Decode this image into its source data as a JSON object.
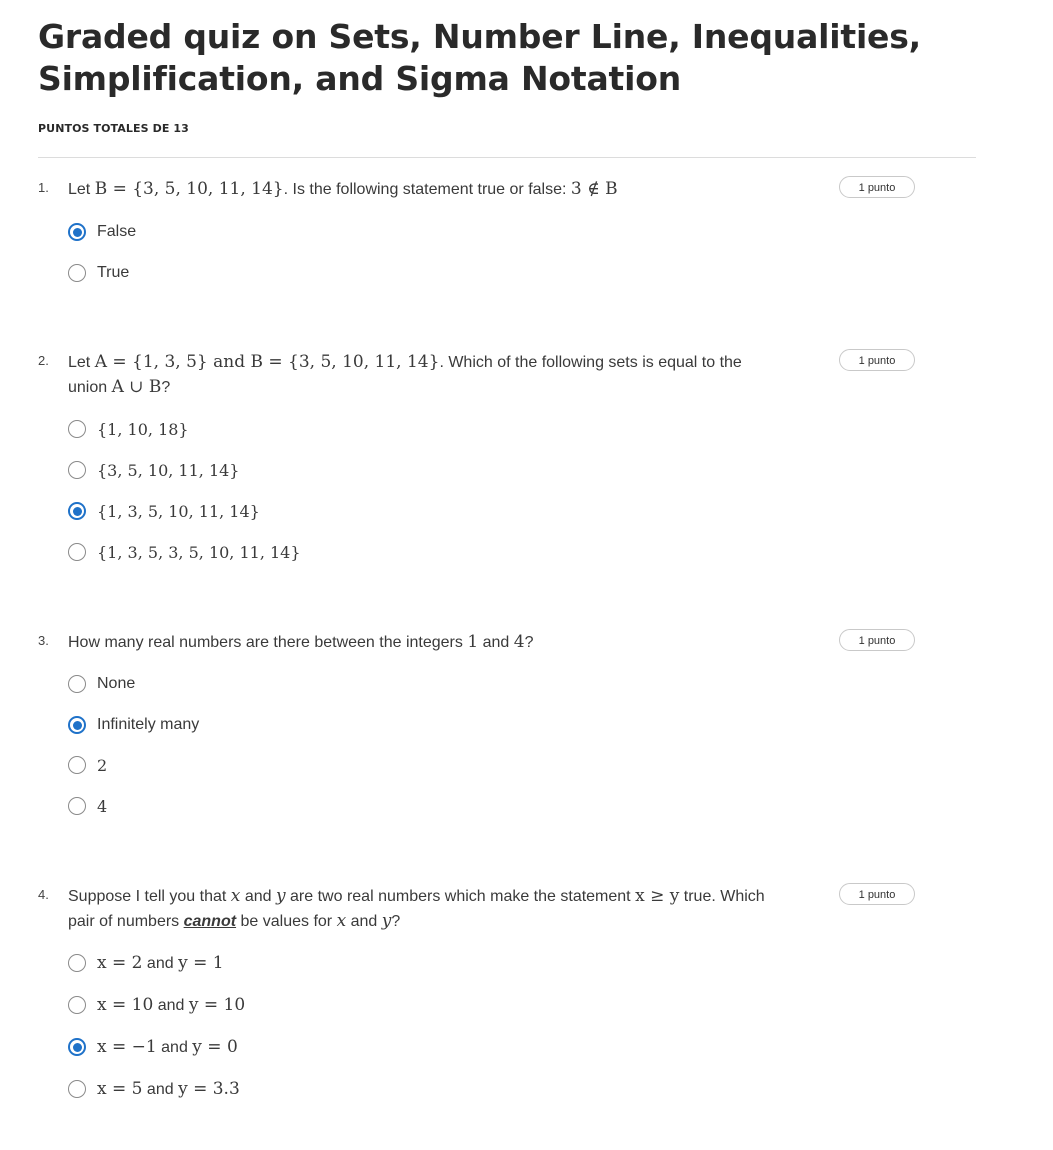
{
  "page_title": "Graded quiz on Sets, Number Line, Inequalities, Simplification, and Sigma Notation",
  "total_points": "PUNTOS TOTALES DE 13",
  "questions": [
    {
      "number": "1.",
      "points": "1 punto",
      "text_parts": [
        "Let ",
        "B = {3, 5, 10, 11, 14}",
        ". Is the following statement true or false: ",
        "3 ∉ B"
      ],
      "options": [
        {
          "label": "False",
          "selected": true
        },
        {
          "label": "True",
          "selected": false
        }
      ]
    },
    {
      "number": "2.",
      "points": "1 punto",
      "text_parts": [
        "Let ",
        "A = {1, 3, 5}",
        " and ",
        "B = {3, 5, 10, 11, 14}",
        ". Which of the following sets is equal to the union ",
        "A ∪ B",
        "?"
      ],
      "options": [
        {
          "label": "{1, 10, 18}",
          "selected": false
        },
        {
          "label": "{3, 5, 10, 11, 14}",
          "selected": false
        },
        {
          "label": "{1, 3, 5, 10, 11, 14}",
          "selected": true
        },
        {
          "label": "{1, 3, 5, 3, 5, 10, 11, 14}",
          "selected": false
        }
      ]
    },
    {
      "number": "3.",
      "points": "1 punto",
      "text_parts": [
        "How many real numbers are there between the integers ",
        "1",
        " and ",
        "4",
        "?"
      ],
      "options": [
        {
          "label": "None",
          "selected": false
        },
        {
          "label": "Infinitely many",
          "selected": true
        },
        {
          "label": "2",
          "selected": false
        },
        {
          "label": "4",
          "selected": false
        }
      ]
    },
    {
      "number": "4.",
      "points": "1 punto",
      "text_parts": [
        "Suppose I tell you that ",
        "x",
        " and ",
        "y",
        " are two real numbers which make the statement ",
        "x ≥ y",
        " true. Which pair of numbers ",
        "cannot",
        " be values for ",
        "x",
        " and ",
        "y",
        "?"
      ],
      "options": [
        {
          "label_parts": [
            "x = 2",
            " and ",
            "y = 1"
          ],
          "selected": false
        },
        {
          "label_parts": [
            "x = 10",
            " and ",
            "y = 10"
          ],
          "selected": false
        },
        {
          "label_parts": [
            "x = −1",
            " and ",
            "y = 0"
          ],
          "selected": true
        },
        {
          "label_parts": [
            "x = 5",
            " and ",
            "y = 3.3"
          ],
          "selected": false
        }
      ]
    }
  ],
  "colors": {
    "accent": "#1f72c9",
    "radio_border": "#8a8a8a",
    "divider": "#dcdcdc"
  },
  "icons": {
    "selected": "radio-checked-icon",
    "unselected": "radio-unchecked-icon"
  }
}
